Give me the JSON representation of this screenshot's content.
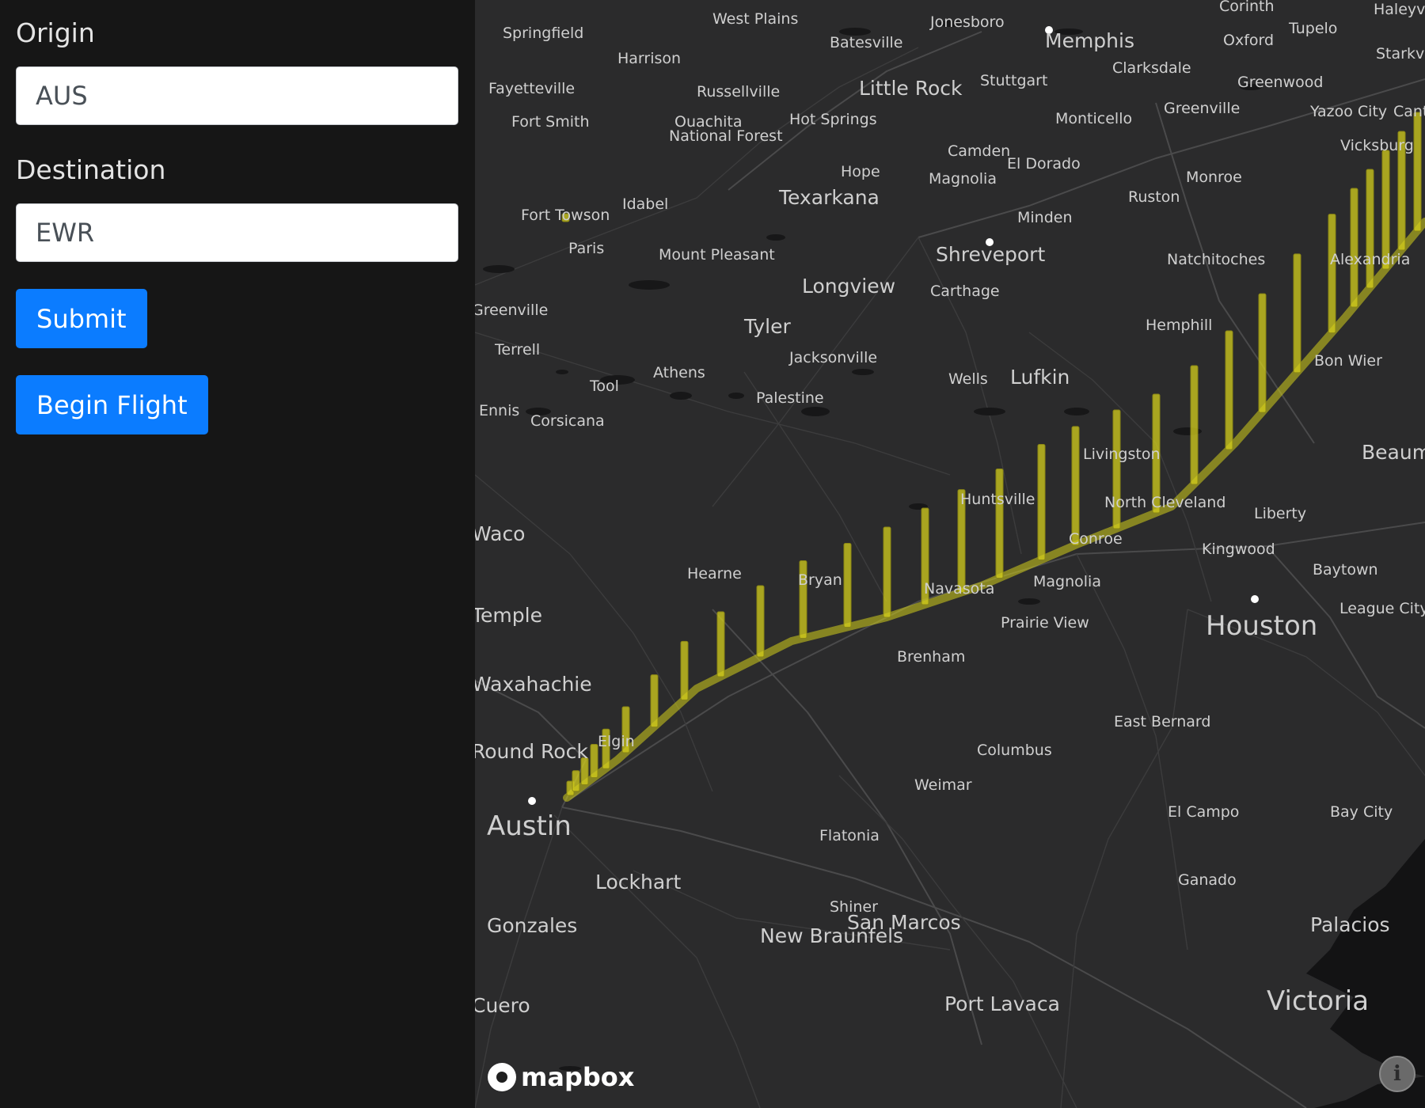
{
  "form": {
    "origin_label": "Origin",
    "origin_value": "AUS",
    "destination_label": "Destination",
    "destination_value": "EWR",
    "submit_label": "Submit",
    "begin_flight_label": "Begin Flight"
  },
  "map": {
    "attribution": "mapbox",
    "info_icon": "i",
    "route_color": "#d4cf1c",
    "cities": [
      {
        "name": "Springfield",
        "size": "small"
      },
      {
        "name": "West Plains",
        "size": "small"
      },
      {
        "name": "Jonesboro",
        "size": "small"
      },
      {
        "name": "Memphis",
        "size": "medium"
      },
      {
        "name": "Corinth",
        "size": "small"
      },
      {
        "name": "Tupelo",
        "size": "small"
      },
      {
        "name": "Haleyville",
        "size": "small"
      },
      {
        "name": "Harrison",
        "size": "small"
      },
      {
        "name": "Batesville",
        "size": "small"
      },
      {
        "name": "Oxford",
        "size": "small"
      },
      {
        "name": "Starkville",
        "size": "small"
      },
      {
        "name": "Fayetteville",
        "size": "small"
      },
      {
        "name": "Russellville",
        "size": "small"
      },
      {
        "name": "Little Rock",
        "size": "medium"
      },
      {
        "name": "Stuttgart",
        "size": "small"
      },
      {
        "name": "Clarksdale",
        "size": "small"
      },
      {
        "name": "Greenwood",
        "size": "small"
      },
      {
        "name": "Fort Smith",
        "size": "small"
      },
      {
        "name": "Hot Springs",
        "size": "small"
      },
      {
        "name": "Monticello",
        "size": "small"
      },
      {
        "name": "Greenville",
        "size": "small"
      },
      {
        "name": "Yazoo City",
        "size": "small"
      },
      {
        "name": "Canton",
        "size": "small"
      },
      {
        "name": "Ouachita",
        "size": "small"
      },
      {
        "name": "National Forest",
        "size": "small"
      },
      {
        "name": "Camden",
        "size": "small"
      },
      {
        "name": "El Dorado",
        "size": "small"
      },
      {
        "name": "Vicksburg",
        "size": "small"
      },
      {
        "name": "Hope",
        "size": "small"
      },
      {
        "name": "Magnolia",
        "size": "small"
      },
      {
        "name": "Monroe",
        "size": "small"
      },
      {
        "name": "Texarkana",
        "size": "medium"
      },
      {
        "name": "Ruston",
        "size": "small"
      },
      {
        "name": "Idabel",
        "size": "small"
      },
      {
        "name": "Fort Towson",
        "size": "small"
      },
      {
        "name": "Minden",
        "size": "small"
      },
      {
        "name": "Paris",
        "size": "small"
      },
      {
        "name": "Mount Pleasant",
        "size": "small"
      },
      {
        "name": "Shreveport",
        "size": "medium"
      },
      {
        "name": "Natchitoches",
        "size": "small"
      },
      {
        "name": "Alexandria",
        "size": "small"
      },
      {
        "name": "Longview",
        "size": "medium"
      },
      {
        "name": "Carthage",
        "size": "small"
      },
      {
        "name": "Greenville",
        "size": "small"
      },
      {
        "name": "Tyler",
        "size": "medium"
      },
      {
        "name": "Hemphill",
        "size": "small"
      },
      {
        "name": "Terrell",
        "size": "small"
      },
      {
        "name": "Jacksonville",
        "size": "small"
      },
      {
        "name": "Bon Wier",
        "size": "small"
      },
      {
        "name": "Athens",
        "size": "small"
      },
      {
        "name": "Tool",
        "size": "small"
      },
      {
        "name": "Wells",
        "size": "small"
      },
      {
        "name": "Lufkin",
        "size": "medium"
      },
      {
        "name": "Palestine",
        "size": "small"
      },
      {
        "name": "Ennis",
        "size": "small"
      },
      {
        "name": "Corsicana",
        "size": "small"
      },
      {
        "name": "Livingston",
        "size": "small"
      },
      {
        "name": "Beaumont",
        "size": "medium"
      },
      {
        "name": "Huntsville",
        "size": "small"
      },
      {
        "name": "North Cleveland",
        "size": "small"
      },
      {
        "name": "Liberty",
        "size": "small"
      },
      {
        "name": "Waco",
        "size": "medium"
      },
      {
        "name": "Conroe",
        "size": "small"
      },
      {
        "name": "Kingwood",
        "size": "small"
      },
      {
        "name": "Hearne",
        "size": "small"
      },
      {
        "name": "Bryan",
        "size": "small"
      },
      {
        "name": "Navasota",
        "size": "small"
      },
      {
        "name": "Magnolia",
        "size": "small"
      },
      {
        "name": "Baytown",
        "size": "small"
      },
      {
        "name": "Temple",
        "size": "medium"
      },
      {
        "name": "Prairie View",
        "size": "small"
      },
      {
        "name": "League City",
        "size": "small"
      },
      {
        "name": "Houston",
        "size": "large"
      },
      {
        "name": "Brenham",
        "size": "small"
      },
      {
        "name": "Waxahachie",
        "size": "medium"
      },
      {
        "name": "East Bernard",
        "size": "small"
      },
      {
        "name": "Elgin",
        "size": "small"
      },
      {
        "name": "Columbus",
        "size": "small"
      },
      {
        "name": "Round Rock",
        "size": "medium"
      },
      {
        "name": "Weimar",
        "size": "small"
      },
      {
        "name": "El Campo",
        "size": "small"
      },
      {
        "name": "Bay City",
        "size": "small"
      },
      {
        "name": "Austin",
        "size": "large"
      },
      {
        "name": "Flatonia",
        "size": "small"
      },
      {
        "name": "Lockhart",
        "size": "medium"
      },
      {
        "name": "Ganado",
        "size": "small"
      },
      {
        "name": "Shiner",
        "size": "small"
      },
      {
        "name": "Palacios",
        "size": "medium"
      },
      {
        "name": "San Marcos",
        "size": "medium"
      },
      {
        "name": "Gonzales",
        "size": "medium"
      },
      {
        "name": "New Braunfels",
        "size": "medium"
      },
      {
        "name": "Cuero",
        "size": "medium"
      },
      {
        "name": "Port Lavaca",
        "size": "medium"
      },
      {
        "name": "Victoria",
        "size": "large"
      }
    ]
  }
}
